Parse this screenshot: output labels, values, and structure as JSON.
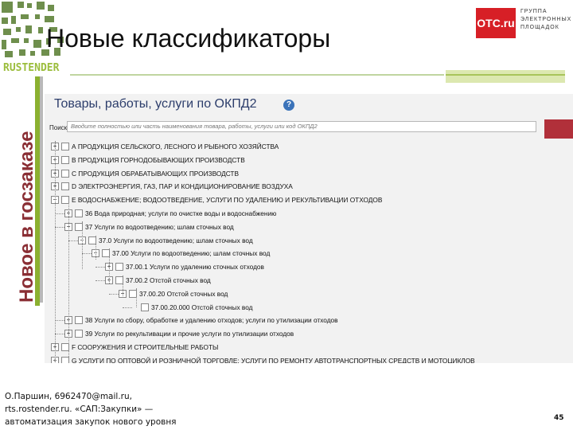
{
  "slide": {
    "title": "Новые классификаторы",
    "vertical_caption": "Новое в госзаказе",
    "logo_text": "RUSTENDER",
    "brand": {
      "otc_label": "OTC.ru",
      "otc_words": [
        "ГРУППА",
        "ЭЛЕКТРОННЫХ",
        "ПЛОЩАДОК"
      ],
      "red": "#d71f26",
      "green": "#8bb030",
      "maroon": "#8a2e34"
    },
    "footer_lines": [
      "О.Паршин, 6962470@mail.ru,",
      "rts.rostender.ru. «САП:Закупки» —",
      "автоматизация закупок нового уровня"
    ],
    "page_number": "45"
  },
  "panel": {
    "title": "Товары, работы, услуги по ОКПД2",
    "help_icon_label": "?",
    "search_label": "Поиск:",
    "search_placeholder": "Вводите полностью или часть наименования товара, работы, услуги или код ОКПД2",
    "tree": [
      {
        "toggle": "+",
        "label": "А ПРОДУКЦИЯ СЕЛЬСКОГО, ЛЕСНОГО И РЫБНОГО ХОЗЯЙСТВА"
      },
      {
        "toggle": "+",
        "label": "В ПРОДУКЦИЯ ГОРНОДОБЫВАЮЩИХ ПРОИЗВОДСТВ"
      },
      {
        "toggle": "+",
        "label": "С ПРОДУКЦИЯ ОБРАБАТЫВАЮЩИХ ПРОИЗВОДСТВ"
      },
      {
        "toggle": "+",
        "label": "D ЭЛЕКТРОЭНЕРГИЯ, ГАЗ, ПАР И КОНДИЦИОНИРОВАНИЕ ВОЗДУХА"
      },
      {
        "toggle": "−",
        "label": "Е ВОДОСНАБЖЕНИЕ; ВОДООТВЕДЕНИЕ, УСЛУГИ ПО УДАЛЕНИЮ И РЕКУЛЬТИВАЦИИ ОТХОДОВ"
      },
      {
        "toggle": "+",
        "label": "36 Вода природная; услуги по очистке воды и водоснабжению"
      },
      {
        "toggle": "−",
        "label": "37 Услуги по водоотведению; шлам сточных вод"
      },
      {
        "toggle": "−",
        "label": "37.0 Услуги по водоотведению; шлам сточных вод"
      },
      {
        "toggle": "−",
        "label": "37.00 Услуги по водоотведению; шлам сточных вод"
      },
      {
        "toggle": "+",
        "label": "37.00.1 Услуги по удалению сточных отходов"
      },
      {
        "toggle": "+",
        "label": "37.00.2 Отстой сточных вод"
      },
      {
        "toggle": "−",
        "label": "37.00.20 Отстой сточных вод"
      },
      {
        "toggle": "",
        "label": "37.00.20.000 Отстой сточных вод"
      },
      {
        "toggle": "+",
        "label": "38 Услуги по сбору, обработке и удалению отходов; услуги по утилизации отходов"
      },
      {
        "toggle": "+",
        "label": "39 Услуги по рекультивации и прочие услуги по утилизации отходов"
      },
      {
        "toggle": "+",
        "label": "F СООРУЖЕНИЯ И СТРОИТЕЛЬНЫЕ РАБОТЫ"
      },
      {
        "toggle": "+",
        "label": "G УСЛУГИ ПО ОПТОВОЙ И РОЗНИЧНОЙ ТОРГОВЛЕ; УСЛУГИ ПО РЕМОНТУ АВТОТРАНСПОРТНЫХ СРЕДСТВ И МОТОЦИКЛОВ"
      }
    ]
  }
}
